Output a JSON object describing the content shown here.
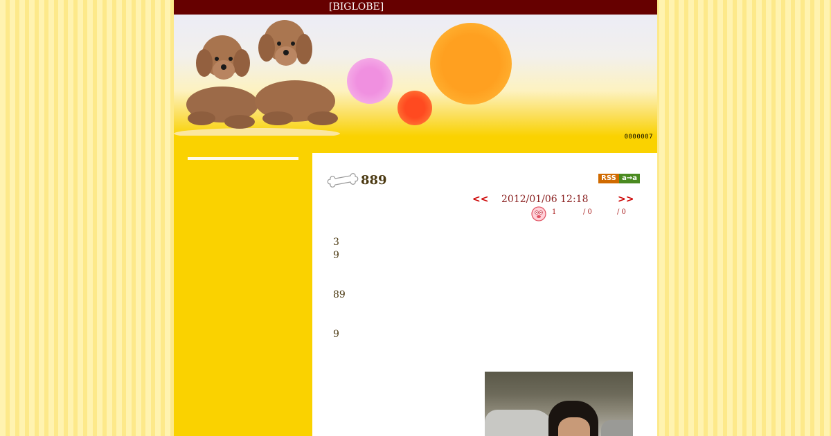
{
  "header": {
    "site_label": "[BIGLOBE]"
  },
  "banner": {
    "counter": "0000007"
  },
  "entry": {
    "title": "889",
    "rss_label": "RSS",
    "rss_alt_label": "a→a",
    "prev_label": "<<",
    "next_label": ">>",
    "date": "2012/01/06 12:18",
    "stats": [
      "1",
      "/ 0",
      "/ 0"
    ],
    "body_lines": [
      "3",
      "9",
      "89",
      "9"
    ]
  },
  "colors": {
    "topbar": "#660000",
    "sidebar": "#fad200",
    "nav_link": "#cc0000",
    "text": "#4a3810"
  },
  "icons": [
    "bone-icon",
    "face-icon",
    "dogs-image"
  ]
}
